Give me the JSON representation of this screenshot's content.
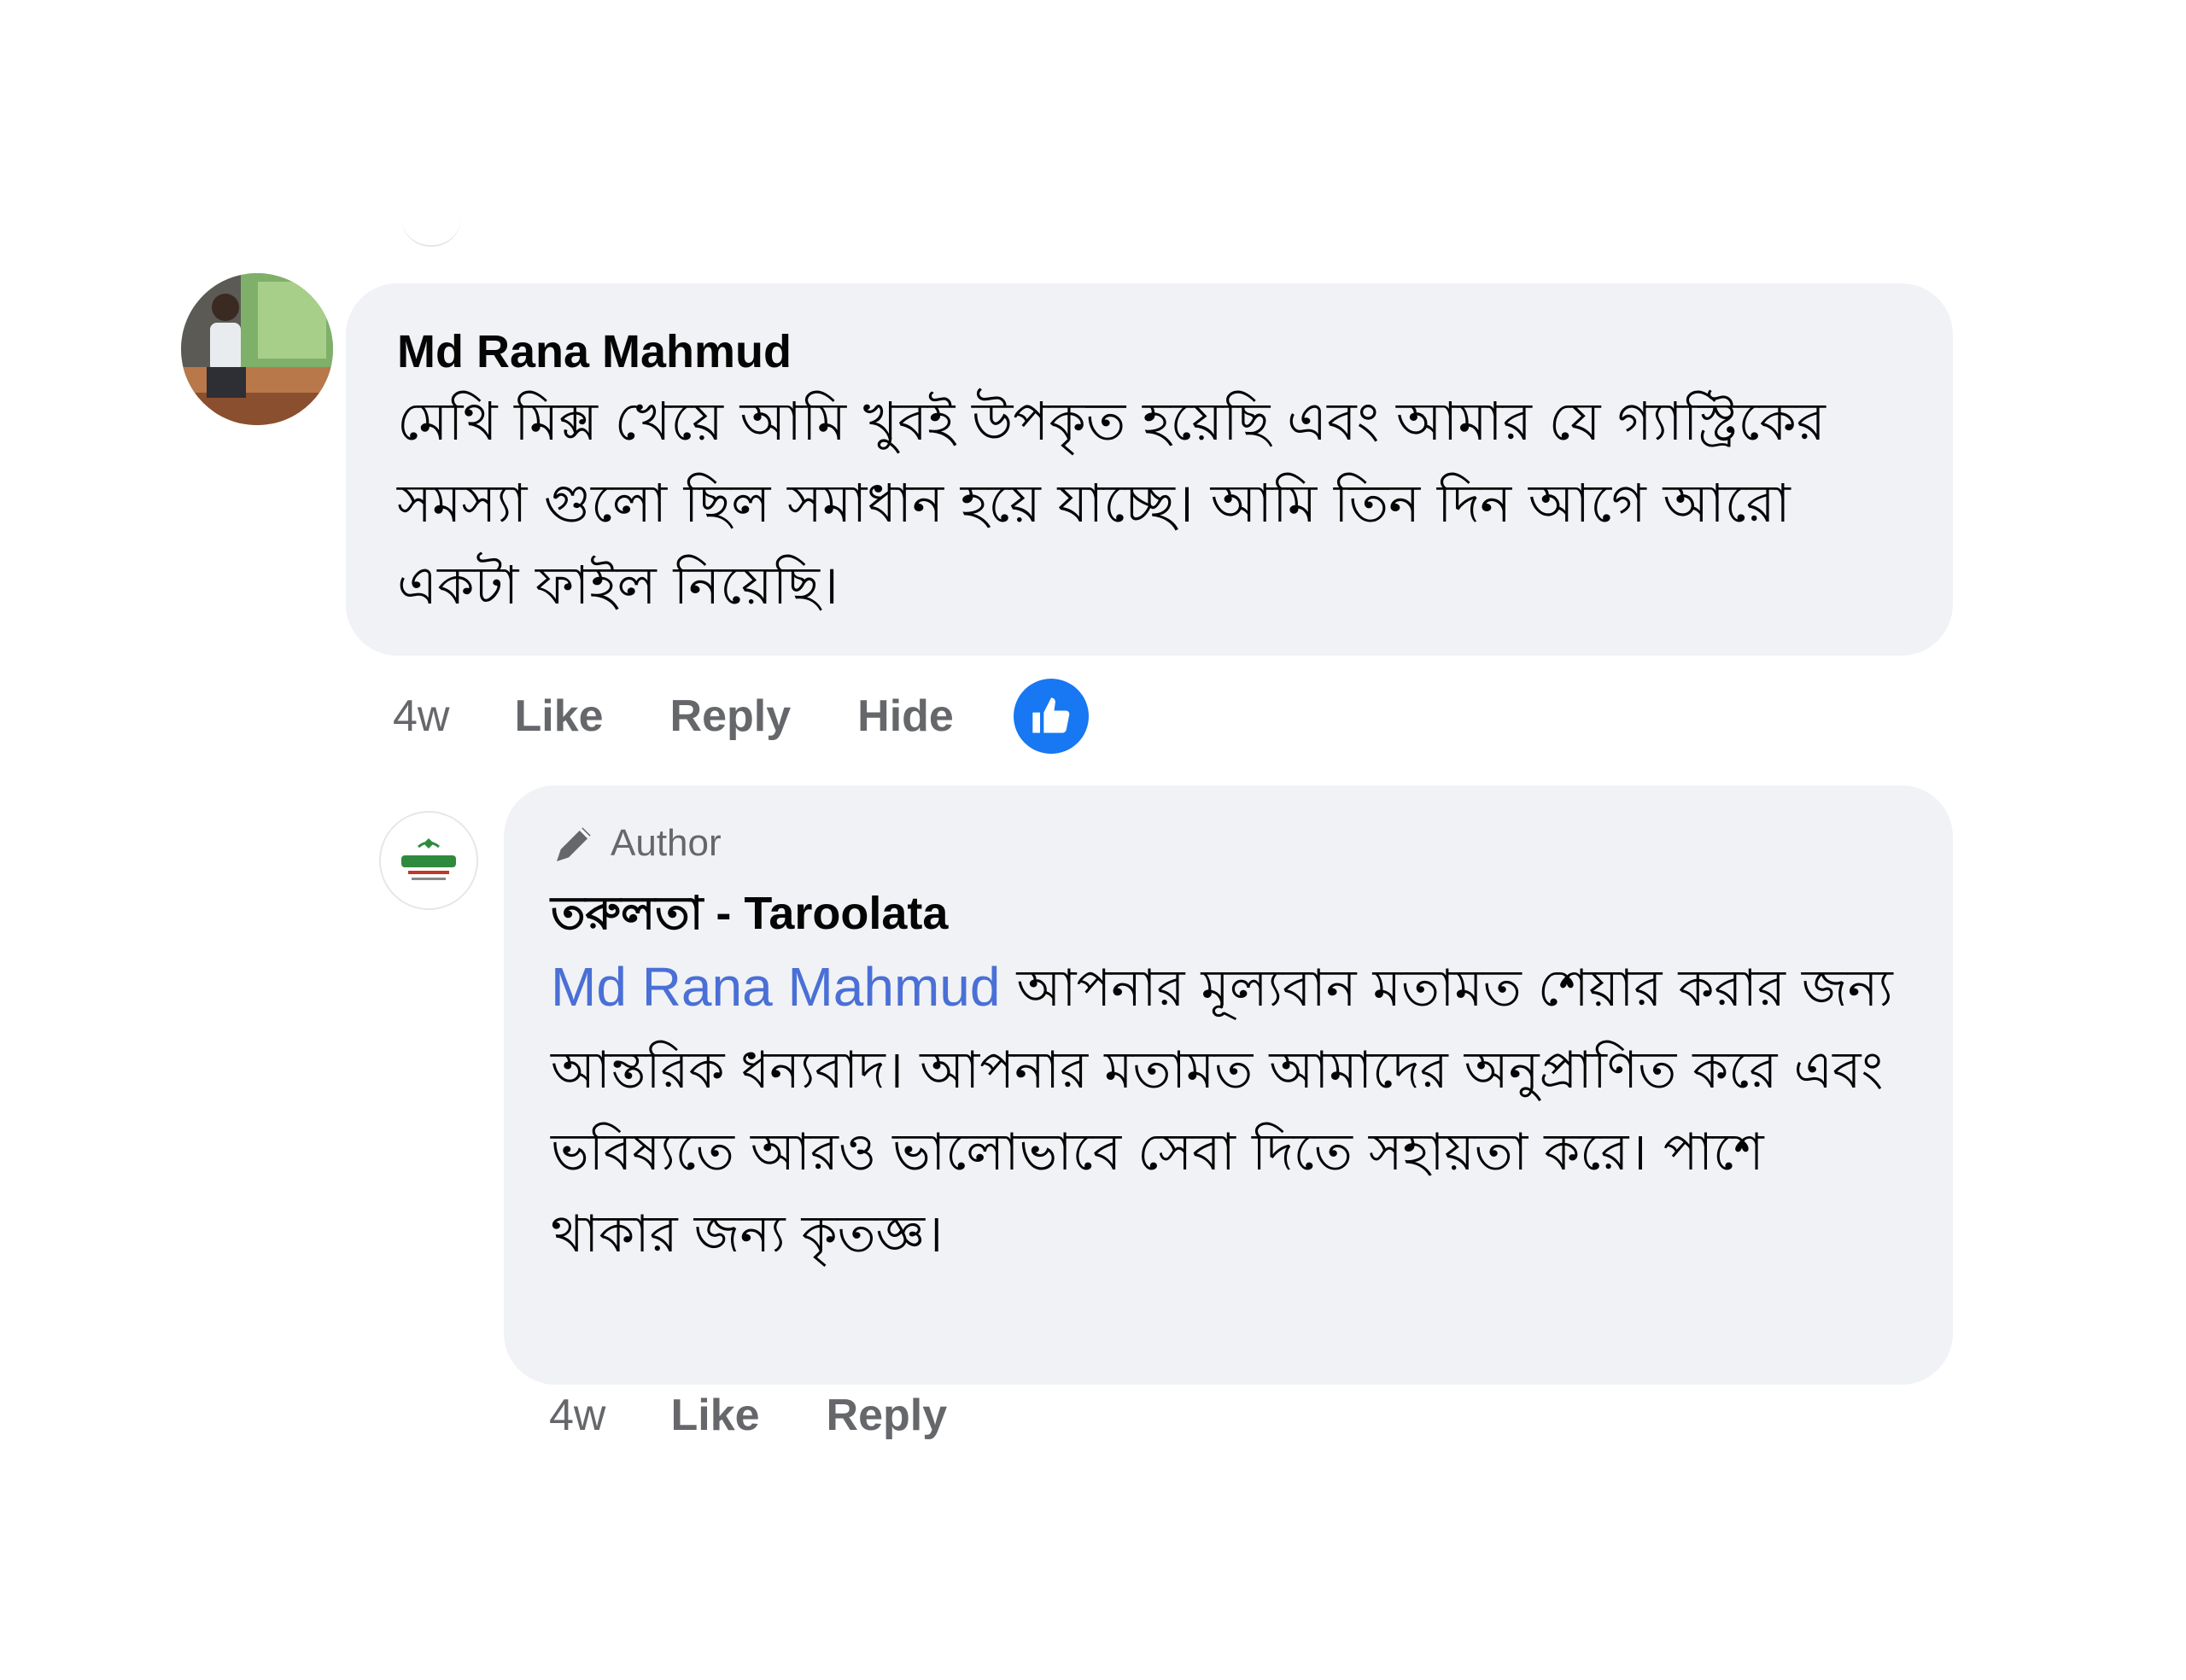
{
  "comment": {
    "author": "Md Rana Mahmud",
    "text": "মেথি মিক্স খেয়ে আমি খুবই উপকৃত হয়েছি এবং আমার যে গ্যাস্ট্রিকের সমস্যা গুলো ছিল সমাধান হয়ে যাচ্ছে। আমি তিন দিন আগে আরো একটা ফাইল নিয়েছি।",
    "time": "4w",
    "actions": [
      "Like",
      "Reply",
      "Hide"
    ],
    "reaction": "like-icon"
  },
  "reply": {
    "badge": "Author",
    "author": "তরুলতা - Taroolata",
    "mention": "Md Rana Mahmud",
    "text": "আপনার মূল্যবান মতামত শেয়ার করার জন্য আন্তরিক ধন্যবাদ। আপনার মতামত আমাদের অনুপ্রাণিত করে এবং ভবিষ্যতে আরও ভালোভাবে সেবা দিতে সহায়তা করে। পাশে থাকার জন্য কৃতজ্ঞ।",
    "time": "4w",
    "actions": [
      "Like",
      "Reply"
    ]
  },
  "colors": {
    "bubble": "#f0f2f5",
    "muted": "#65676b",
    "like_blue": "#1877f2",
    "mention": "#4a6fd6"
  }
}
